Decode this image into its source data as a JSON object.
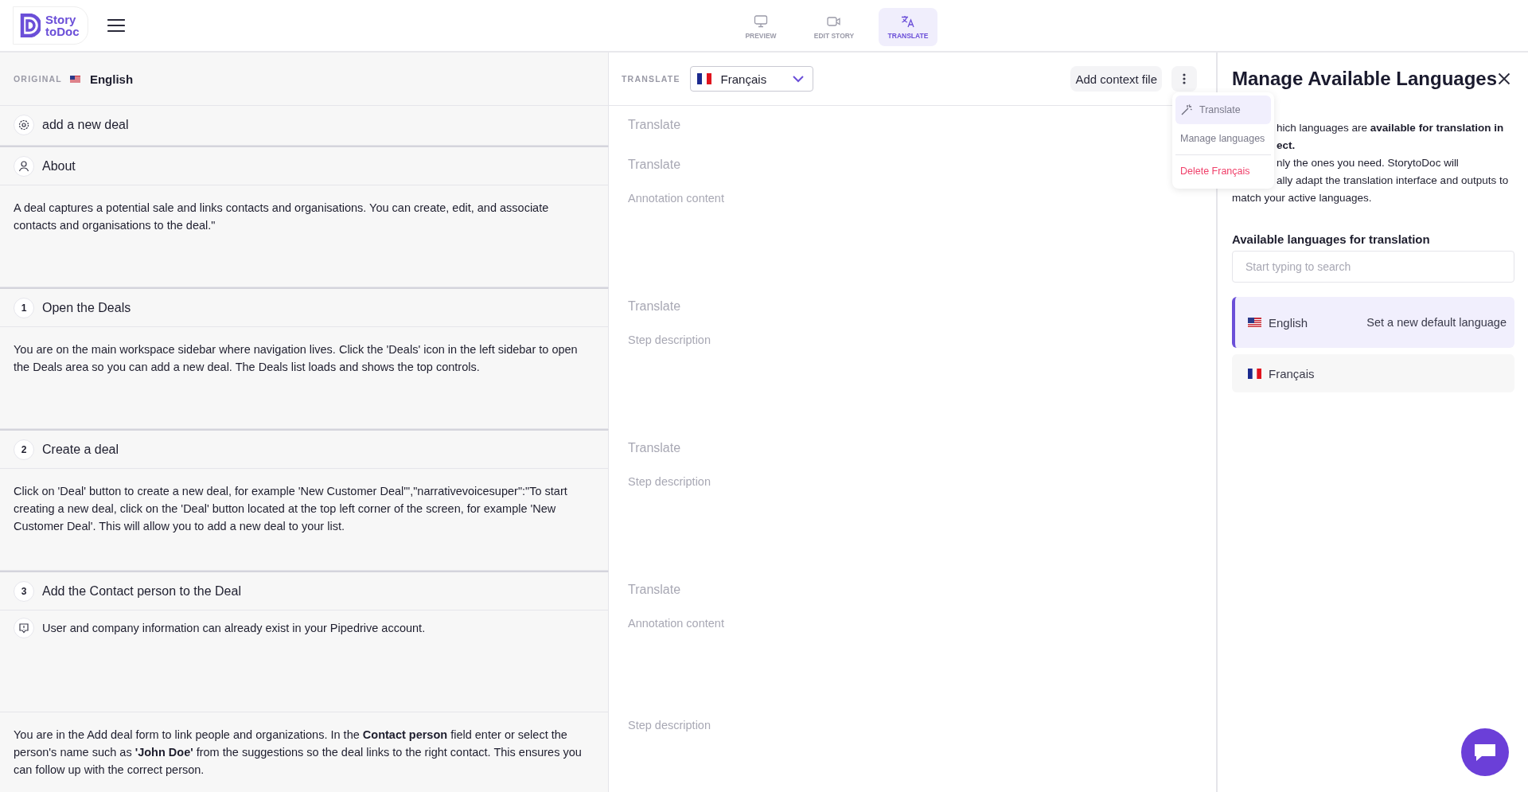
{
  "header": {
    "logo_lines": [
      "Story",
      "toDoc"
    ],
    "tabs": [
      {
        "label": "PREVIEW",
        "selected": false
      },
      {
        "label": "EDIT STORY",
        "selected": false
      },
      {
        "label": "TRANSLATE",
        "selected": true
      }
    ]
  },
  "toolbar": {
    "original_label": "ORIGINAL",
    "original_language": "English",
    "translate_label": "TRANSLATE",
    "target_language": "Français",
    "add_context_button": "Add context file"
  },
  "menu": {
    "items": [
      {
        "label": "Translate",
        "kind": "action",
        "selected": true
      },
      {
        "label": "Manage languages",
        "kind": "plain",
        "selected": false
      },
      {
        "label": "Delete Français",
        "kind": "danger",
        "selected": false
      }
    ]
  },
  "rows": [
    {
      "kind": "title",
      "text": "add a new deal",
      "placeholder": "Translate"
    },
    {
      "kind": "section",
      "text": "About",
      "placeholder": "Translate"
    },
    {
      "kind": "body",
      "text": "A deal captures a potential sale and links contacts and organisations. You can create, edit, and associate contacts and organisations to the deal.\"",
      "placeholder": "Annotation content"
    },
    {
      "kind": "step",
      "number": "1",
      "text": "Open the Deals",
      "placeholder": "Translate"
    },
    {
      "kind": "body",
      "text": "You are on the main workspace sidebar where navigation lives. Click the 'Deals' icon in the left sidebar to open the Deals area so you can add a new deal. The Deals list loads and shows the top controls.",
      "placeholder": "Step description"
    },
    {
      "kind": "step",
      "number": "2",
      "text": "Create a deal",
      "placeholder": "Translate"
    },
    {
      "kind": "body",
      "text": "Click on 'Deal' button to create a new deal, for example 'New Customer Deal'\",\"narrativevoicesuper\":\"To start creating a new deal, click on the 'Deal' button located at the top left corner of the screen, for example 'New Customer Deal'. This will allow you to add a new deal to your list.",
      "placeholder": "Step description"
    },
    {
      "kind": "step",
      "number": "3",
      "text": "Add the Contact person to the Deal",
      "placeholder": "Translate"
    },
    {
      "kind": "note",
      "text": "User and company information can already exist in your Pipedrive account.",
      "placeholder": "Annotation content"
    },
    {
      "kind": "body",
      "text": "You are in the Add deal form to link people and organizations. In the **Contact person** field enter or select the person's name such as **'John Doe'** from the suggestions so the deal links to the right contact. This ensures you can follow up with the correct person.",
      "placeholder": "Step description"
    }
  ],
  "panel": {
    "title": "Manage Available Languages",
    "intro_lines": [
      "hich languages are **available for translation in**",
      "**ect.**",
      "nly the ones you need. StorytoDoc will",
      "ally adapt the translation interface and outputs to",
      "match your active languages."
    ],
    "list_label": "Available languages for translation",
    "search": {
      "placeholder": "Start typing to search"
    },
    "languages": [
      {
        "name": "English",
        "selected": true,
        "action": "Set a new default language"
      },
      {
        "name": "Français",
        "selected": false
      }
    ]
  }
}
